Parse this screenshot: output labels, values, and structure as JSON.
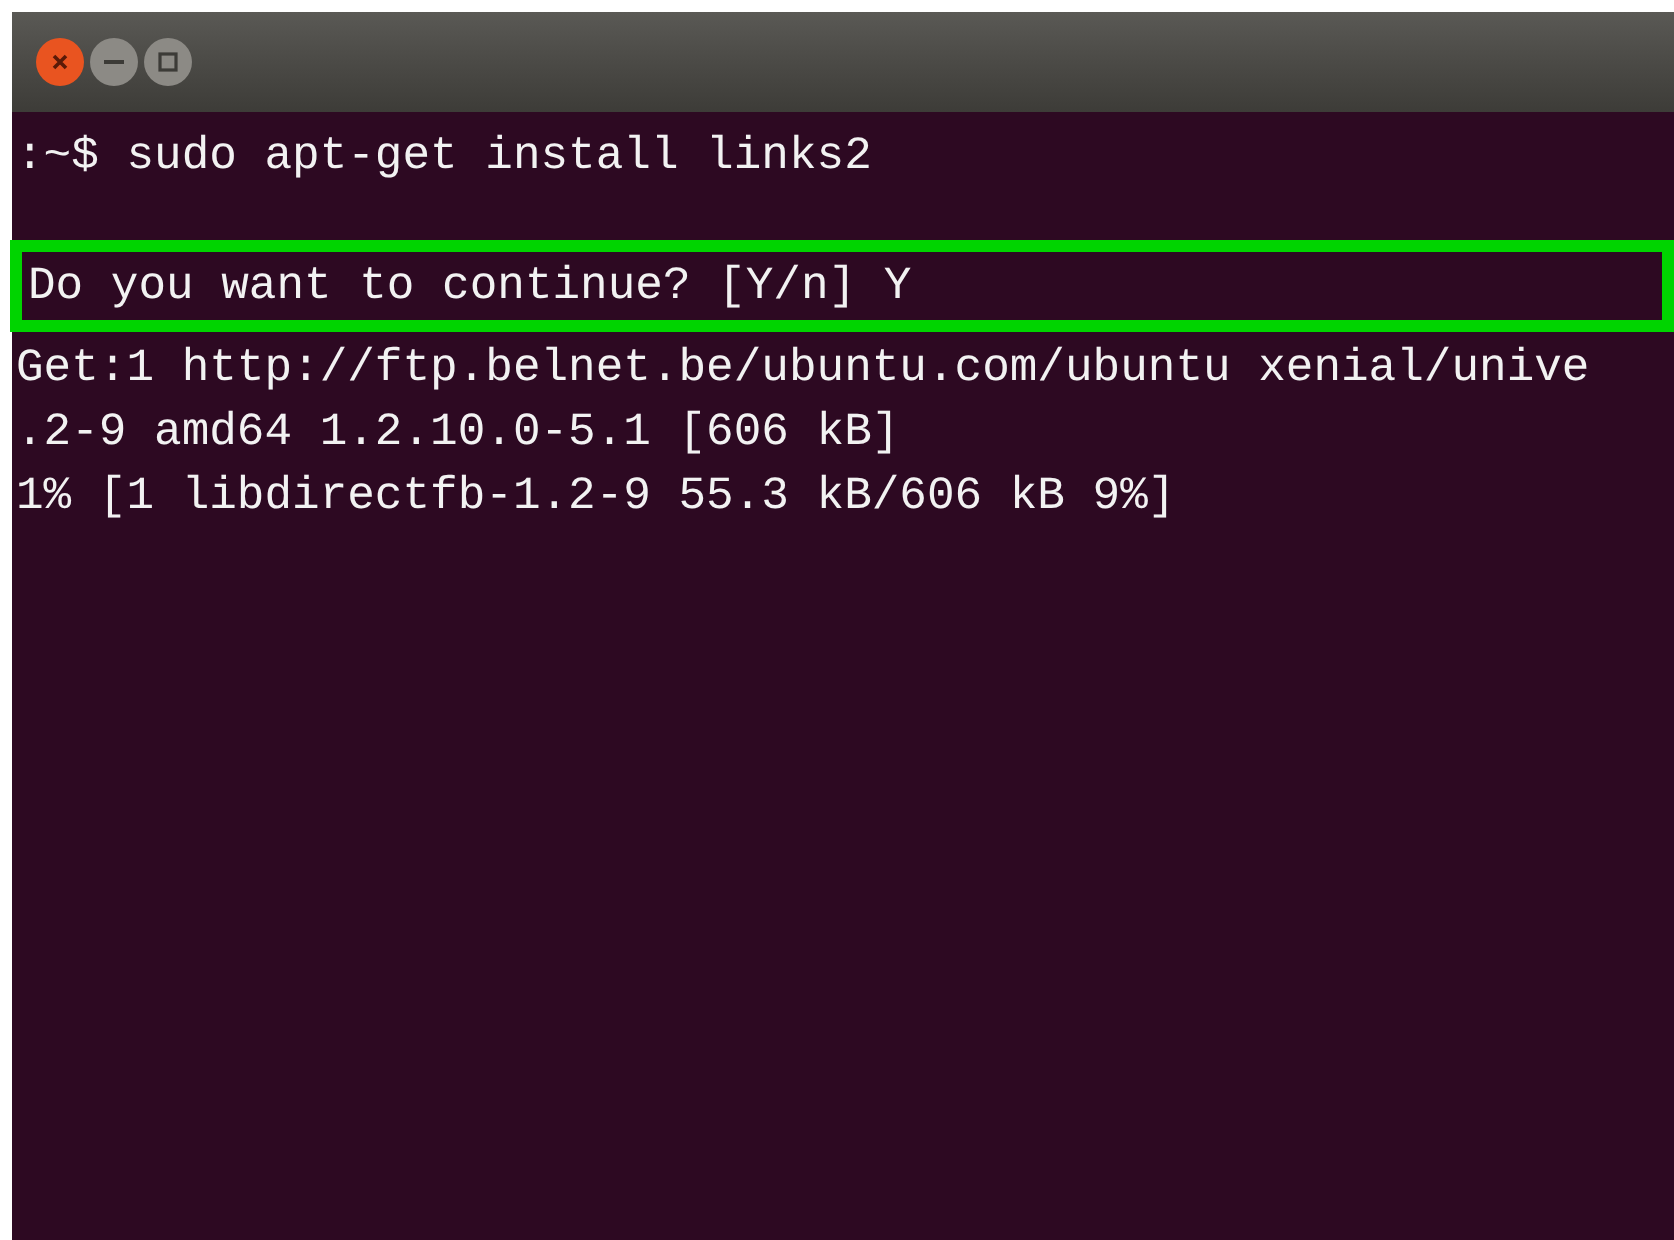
{
  "terminal": {
    "command_line": ":~$ sudo apt-get install links2",
    "highlighted_line": "Do you want to continue? [Y/n] Y",
    "output_lines": [
      "Get:1 http://ftp.belnet.be/ubuntu.com/ubuntu xenial/unive",
      ".2-9 amd64 1.2.10.0-5.1 [606 kB]",
      "1% [1 libdirectfb-1.2-9 55.3 kB/606 kB 9%]"
    ]
  }
}
